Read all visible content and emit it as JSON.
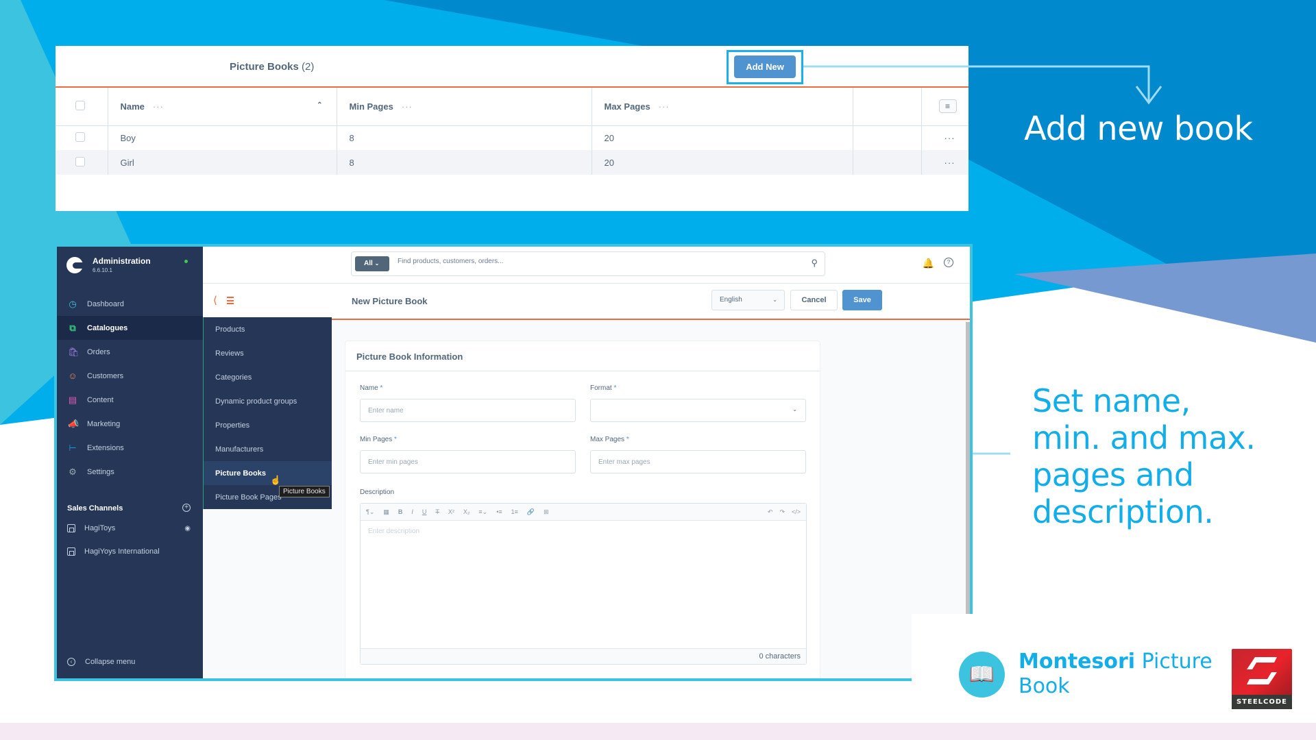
{
  "colors": {
    "brand_blue": "#12aee9",
    "accent_orange": "#f06a3b",
    "primary_button": "#4f93d0",
    "sidebar_bg": "#253656",
    "frame_cyan": "#3cc3df"
  },
  "list_view": {
    "title": "Picture Books",
    "count": "(2)",
    "add_new_label": "Add New",
    "columns": [
      {
        "label": "Name",
        "menu": "···",
        "sort_icon": "chevron-up-icon"
      },
      {
        "label": "Min Pages",
        "menu": "···"
      },
      {
        "label": "Max Pages",
        "menu": "···"
      }
    ],
    "column_settings_icon": "≡",
    "row_menu": "···",
    "rows": [
      {
        "name": "Boy",
        "min_pages": "8",
        "max_pages": "20"
      },
      {
        "name": "Girl",
        "min_pages": "8",
        "max_pages": "20"
      }
    ]
  },
  "captions": {
    "add_new_book": "Add new book",
    "set_fields": "Set name,\nmin. and max.\npages and\ndescription."
  },
  "admin": {
    "brand_title": "Administration",
    "version": "6.6.10.1",
    "nav": [
      {
        "label": "Dashboard",
        "icon": "dashboard-icon",
        "color": "#3cc3df"
      },
      {
        "label": "Catalogues",
        "icon": "catalogues-icon",
        "color": "#37c47e",
        "active": true
      },
      {
        "label": "Orders",
        "icon": "orders-icon",
        "color": "#9b7be0"
      },
      {
        "label": "Customers",
        "icon": "customers-icon",
        "color": "#f28a5a"
      },
      {
        "label": "Content",
        "icon": "content-icon",
        "color": "#e05ab8"
      },
      {
        "label": "Marketing",
        "icon": "marketing-icon",
        "color": "#f2c21b"
      },
      {
        "label": "Extensions",
        "icon": "extensions-icon",
        "color": "#1b9ae0"
      },
      {
        "label": "Settings",
        "icon": "settings-icon",
        "color": "#9aa8b5"
      }
    ],
    "sales_channels": {
      "heading": "Sales Channels",
      "items": [
        {
          "label": "HagiToys"
        },
        {
          "label": "HagiYoys International"
        }
      ]
    },
    "collapse_label": "Collapse menu",
    "search": {
      "type_label": "All",
      "placeholder": "Find products, customers, orders..."
    },
    "flyout": [
      "Products",
      "Reviews",
      "Categories",
      "Dynamic product groups",
      "Properties",
      "Manufacturers",
      "Picture Books",
      "Picture Book Pages"
    ],
    "tooltip": "Picture Books",
    "page_title": "New Picture Book",
    "language": "English",
    "cancel_label": "Cancel",
    "save_label": "Save",
    "form": {
      "card_title": "Picture Book Information",
      "name_label": "Name",
      "name_placeholder": "Enter name",
      "format_label": "Format",
      "min_label": "Min Pages",
      "min_placeholder": "Enter min pages",
      "max_label": "Max Pages",
      "max_placeholder": "Enter max pages",
      "required_mark": "*",
      "description_label": "Description",
      "description_placeholder": "Enter description",
      "char_count": "0 characters"
    }
  },
  "product": {
    "name_bold": "Montesori",
    "name_rest": " Picture",
    "name_line2": "Book",
    "vendor": "STEELCODE"
  }
}
